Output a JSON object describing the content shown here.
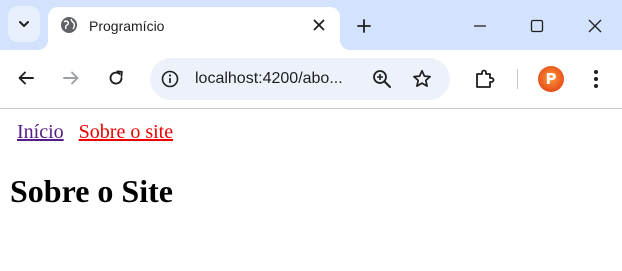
{
  "browser": {
    "tab": {
      "title": "Programício",
      "favicon": "globe-icon"
    },
    "address_bar": {
      "url": "localhost:4200/abo..."
    },
    "profile": {
      "initial": "P",
      "color": "#e8551b"
    },
    "colors": {
      "tabstrip": "#d3e3fd",
      "omnibox": "#edf2fa"
    }
  },
  "page": {
    "nav": {
      "links": [
        {
          "label": "Início",
          "color": "#551a8b"
        },
        {
          "label": "Sobre o site",
          "color": "#ee0000"
        }
      ]
    },
    "heading": "Sobre o Site"
  }
}
